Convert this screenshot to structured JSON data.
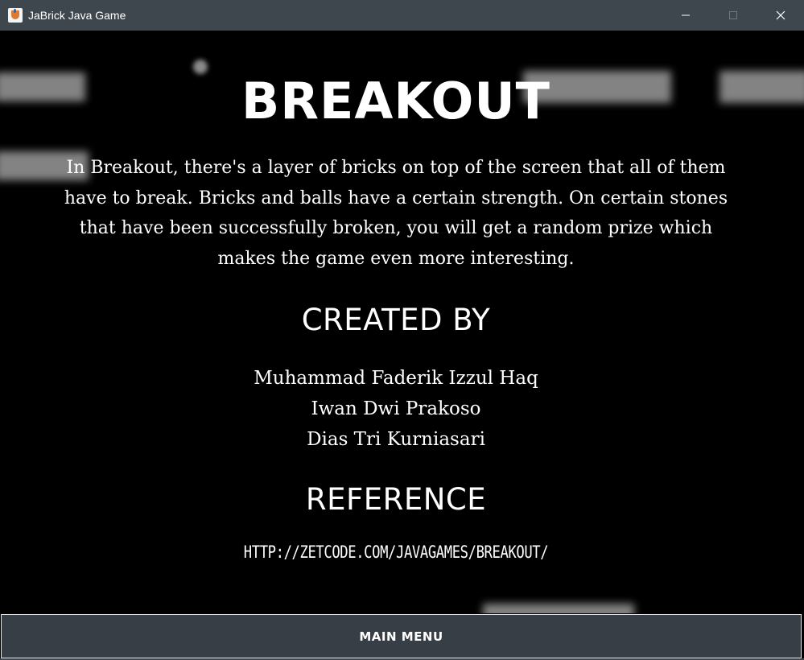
{
  "window": {
    "title": "JaBrick Java Game",
    "titlebar_color": "#3f474e"
  },
  "controls": {
    "minimize_icon": "minimize-icon",
    "maximize_icon": "maximize-icon",
    "close_icon": "close-icon"
  },
  "about": {
    "title": "BREAKOUT",
    "description": "In Breakout, there's a layer of bricks on top of the screen that all of them have to break. Bricks and balls have a certain strength. On certain stones that have been successfully broken, you will get a random prize which makes the game even more interesting.",
    "created_heading": "CREATED BY",
    "authors": [
      "Muhammad Faderik Izzul Haq",
      "Iwan Dwi Prakoso",
      "Dias Tri Kurniasari"
    ],
    "reference_heading": "REFERENCE",
    "reference_link": "HTTP://ZETCODE.COM/JAVAGAMES/BREAKOUT/"
  },
  "footer": {
    "main_menu_label": "MAIN MENU",
    "button_color": "#373e45"
  }
}
